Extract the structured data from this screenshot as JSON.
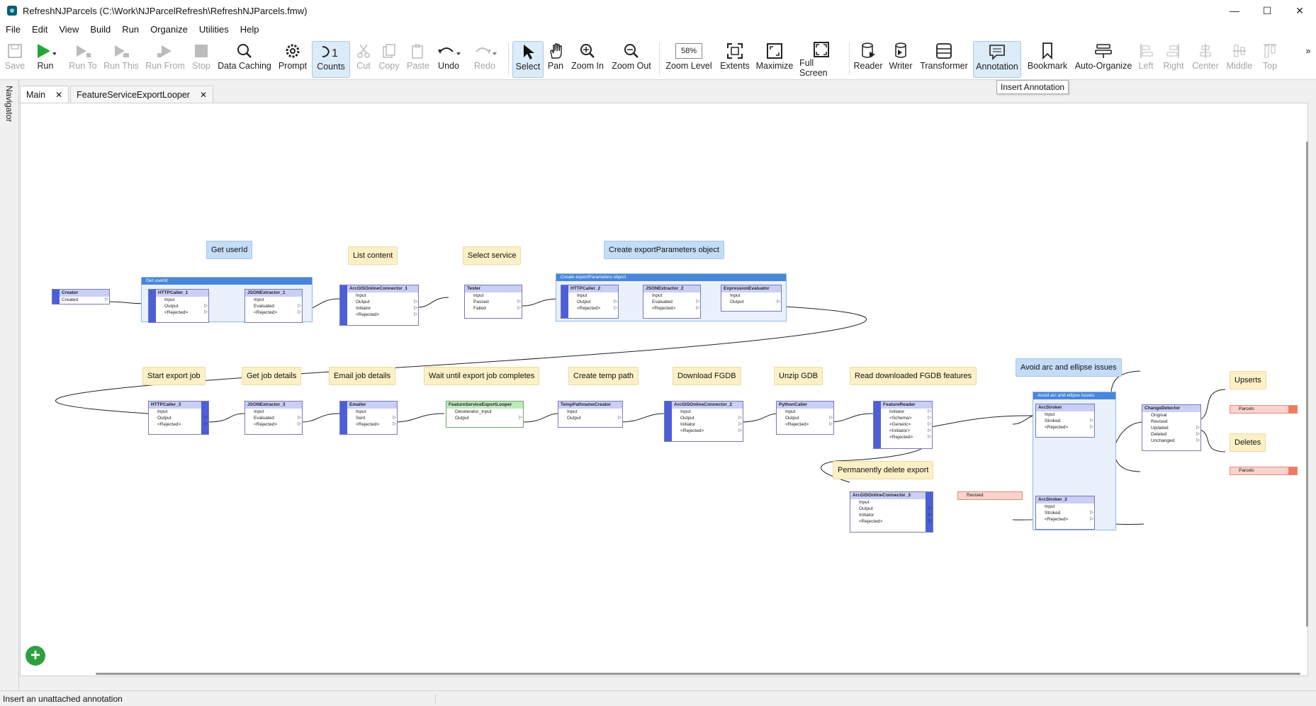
{
  "window": {
    "title": "RefreshNJParcels (C:\\Work\\NJParcelRefresh\\RefreshNJParcels.fmw)",
    "minimize_glyph": "—",
    "maximize_glyph": "☐",
    "close_glyph": "✕"
  },
  "menu": [
    "File",
    "Edit",
    "View",
    "Build",
    "Run",
    "Organize",
    "Utilities",
    "Help"
  ],
  "toolbar": {
    "save": "Save",
    "run": "Run",
    "run_to": "Run To",
    "run_this": "Run This",
    "run_from": "Run From",
    "stop": "Stop",
    "data_caching": "Data Caching",
    "prompt": "Prompt",
    "counts": "Counts",
    "cut": "Cut",
    "copy": "Copy",
    "paste": "Paste",
    "undo": "Undo",
    "redo": "Redo",
    "select": "Select",
    "pan": "Pan",
    "zoom_in": "Zoom In",
    "zoom_out": "Zoom Out",
    "zoom_value": "58%",
    "zoom_level": "Zoom Level",
    "extents": "Extents",
    "maximize": "Maximize",
    "full_screen": "Full Screen",
    "reader": "Reader",
    "writer": "Writer",
    "transformer": "Transformer",
    "annotation": "Annotation",
    "bookmark": "Bookmark",
    "auto_organize": "Auto-Organize",
    "left": "Left",
    "right": "Right",
    "center": "Center",
    "middle": "Middle",
    "top": "Top",
    "more": "»"
  },
  "tooltip": "Insert Annotation",
  "navigator": "Navigator",
  "tabs": [
    {
      "label": "Main",
      "close": "✕"
    },
    {
      "label": "FeatureServiceExportLooper",
      "close": "✕"
    }
  ],
  "annotations": {
    "get_userid": "Get userId",
    "list_content": "List content",
    "select_service": "Select service",
    "create_export": "Create exportParameters object",
    "start_export": "Start export job",
    "get_job": "Get job details",
    "email_job": "Email job details",
    "wait_export": "Wait until export job completes",
    "create_temp": "Create temp path",
    "download_fgdb": "Download FGDB",
    "unzip_gdb": "Unzip GDB",
    "read_fgdb": "Read downloaded FGDB features",
    "avoid_arc": "Avoid arc and ellipse issues",
    "perm_delete": "Permanently delete export",
    "upserts": "Upserts",
    "deletes": "Deletes"
  },
  "bookmarks": {
    "get_userid": "Get userId",
    "create_export": "Create exportParameters object",
    "avoid_arc": "Avoid arc and ellipse issues"
  },
  "transformers": {
    "creator": {
      "name": "Creator",
      "ports": [
        "Created"
      ]
    },
    "httpcaller1": {
      "name": "HTTPCaller_1",
      "ports": [
        "Input",
        "Output",
        "<Rejected>"
      ]
    },
    "jsonextractor1": {
      "name": "JSONExtractor_1",
      "ports": [
        "Input",
        "Evaluated",
        "<Rejected>"
      ]
    },
    "agol1": {
      "name": "ArcGISOnlineConnector_1",
      "ports": [
        "Input",
        "Output",
        "Initiator",
        "<Rejected>"
      ]
    },
    "tester": {
      "name": "Tester",
      "ports": [
        "Input",
        "Passed",
        "Failed"
      ]
    },
    "httpcaller2": {
      "name": "HTTPCaller_2",
      "ports": [
        "Input",
        "Output",
        "<Rejected>"
      ]
    },
    "jsonextractor2": {
      "name": "JSONExtractor_2",
      "ports": [
        "Input",
        "Evaluated",
        "<Rejected>"
      ]
    },
    "exprevaluator": {
      "name": "ExpressionEvaluator",
      "ports": [
        "Input",
        "Output"
      ]
    },
    "httpcaller3": {
      "name": "HTTPCaller_3",
      "ports": [
        "Input",
        "Output",
        "<Rejected>"
      ]
    },
    "jsonextractor3": {
      "name": "JSONExtractor_3",
      "ports": [
        "Input",
        "Evaluated",
        "<Rejected>"
      ]
    },
    "emailer": {
      "name": "Emailer",
      "ports": [
        "Input",
        "Sent",
        "<Rejected>"
      ]
    },
    "looper": {
      "name": "FeatureServiceExportLooper",
      "ports": [
        "Decelerator_Input",
        "Output"
      ]
    },
    "temppath": {
      "name": "TempPathnameCreator",
      "ports": [
        "Input",
        "Output"
      ]
    },
    "agol2": {
      "name": "ArcGISOnlineConnector_2",
      "ports": [
        "Input",
        "Output",
        "Initiator",
        "<Rejected>"
      ]
    },
    "pythoncaller": {
      "name": "PythonCaller",
      "ports": [
        "Input",
        "Output",
        "<Rejected>"
      ]
    },
    "featurereader": {
      "name": "FeatureReader",
      "ports": [
        "Initiator",
        "<Schema>",
        "<Generic>",
        "<Initiator>",
        "<Rejected>"
      ]
    },
    "arcstroker": {
      "name": "ArcStroker",
      "ports": [
        "Input",
        "Stroked",
        "<Rejected>"
      ]
    },
    "arcstroker2": {
      "name": "ArcStroker_2",
      "ports": [
        "Input",
        "Stroked",
        "<Rejected>"
      ]
    },
    "changedetector": {
      "name": "ChangeDetector",
      "ports": [
        "Original",
        "Revised",
        "Updated",
        "Deleted",
        "Unchanged"
      ]
    },
    "agol3": {
      "name": "ArcGISOnlineConnector_3",
      "ports": [
        "Input",
        "Output",
        "Initiator",
        "<Rejected>"
      ]
    }
  },
  "features": {
    "revised": "Revised",
    "parcels_upsert": "Parcels",
    "parcels_delete": "Parcels"
  },
  "status": "Insert an unattached annotation",
  "add_button": "+"
}
